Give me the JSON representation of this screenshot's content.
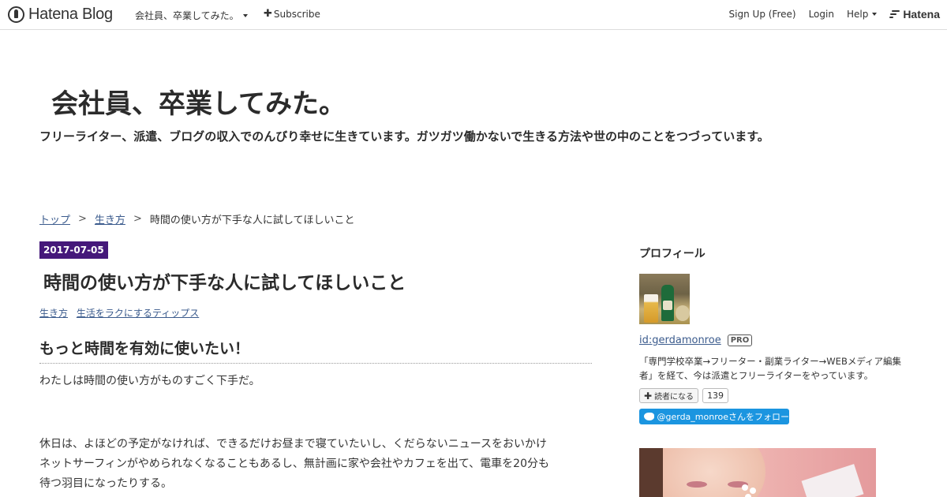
{
  "topbar": {
    "brand": "Hatena Blog",
    "blog_menu": "会社員、卒業してみた。",
    "subscribe": "Subscribe",
    "signup": "Sign Up (Free)",
    "login": "Login",
    "help": "Help",
    "hatena": "Hatena"
  },
  "header": {
    "title": "会社員、卒業してみた。",
    "description": "フリーライター、派遣、ブログの収入でのんびり幸せに生きています。ガツガツ働かないで生きる方法や世の中のことをつづっています。"
  },
  "breadcrumb": {
    "items": [
      "トップ",
      "生き方"
    ],
    "current": "時間の使い方が下手な人に試してほしいこと",
    "separator": ">"
  },
  "entry": {
    "date": "2017-07-05",
    "title": "時間の使い方が下手な人に試してほしいこと",
    "categories": [
      "生き方",
      "生活をラクにするティップス"
    ],
    "section_heading": "もっと時間を有効に使いたい！",
    "paragraphs": [
      "わたしは時間の使い方がものすごく下手だ。",
      "休日は、よほどの予定がなければ、できるだけお昼まで寝ていたいし、くだらないニュースをおいかけ",
      "ネットサーフィンがやめられなくなることもあるし、無計画に家や会社やカフェを出て、電車を20分も",
      "待つ羽目になったりする。"
    ]
  },
  "sidebar": {
    "title": "プロフィール",
    "user_id": "id:gerdamonroe",
    "badge": "PRO",
    "description": "「専門学校卒業→フリーター・副業ライター→WEBメディア編集者」を経て、今は派遣とフリーライターをやっています。",
    "reader_button": "読者になる",
    "reader_count": "139",
    "follow_button": "@gerda_monroeさんをフォロー"
  },
  "colors": {
    "date_badge": "#45187a",
    "link": "#3b5b8d",
    "twitter": "#1b95e0"
  }
}
